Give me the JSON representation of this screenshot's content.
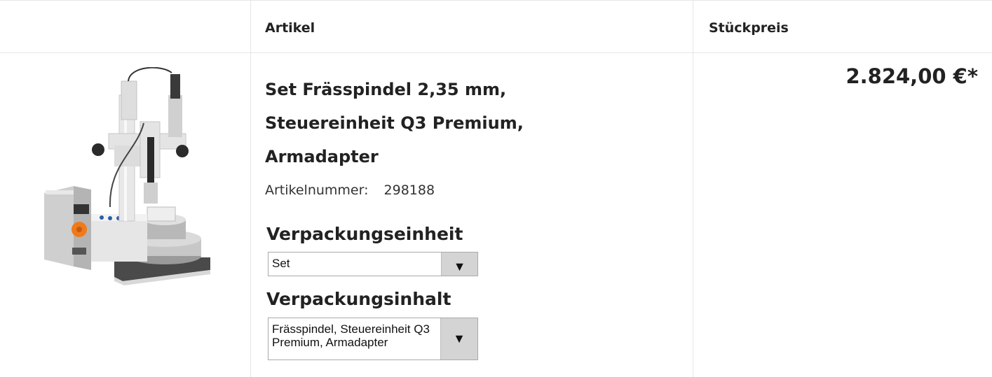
{
  "table": {
    "header": {
      "col_article": "Artikel",
      "col_unit_price": "Stückpreis"
    },
    "row": {
      "title_lines": [
        "Set Frässpindel 2,35 mm,",
        "Steuereinheit Q3 Premium,",
        "Armadapter"
      ],
      "article_number_label": "Artikelnummer:",
      "article_number": "298188",
      "packaging_unit": {
        "heading": "Verpackungseinheit",
        "selected": "Set"
      },
      "packaging_content": {
        "heading": "Verpackungsinhalt",
        "selected": "Frässpindel, Steuereinheit Q3 Premium, Armadapter"
      },
      "price": "2.824,00 €*"
    }
  },
  "icons": {
    "dropdown": "▼"
  }
}
